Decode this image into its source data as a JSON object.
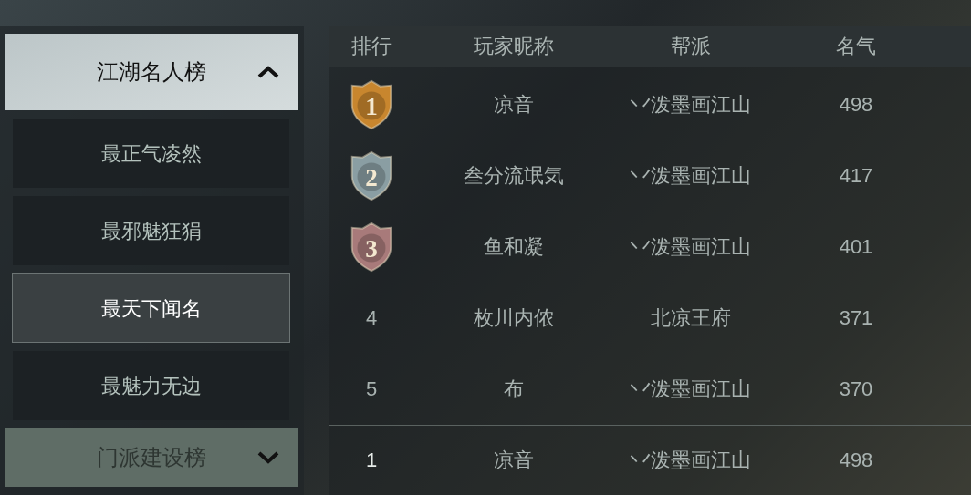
{
  "sidebar": {
    "groups": [
      {
        "label": "江湖名人榜",
        "expanded": true,
        "items": [
          {
            "label": "最正气凌然",
            "selected": false
          },
          {
            "label": "最邪魅狂狷",
            "selected": false
          },
          {
            "label": "最天下闻名",
            "selected": true
          },
          {
            "label": "最魅力无边",
            "selected": false
          }
        ]
      },
      {
        "label": "门派建设榜",
        "expanded": false
      }
    ]
  },
  "table": {
    "columns": [
      "排行",
      "玩家昵称",
      "帮派",
      "名气"
    ],
    "rows": [
      {
        "kind": "medal",
        "rank": "1",
        "color": "#c8862e",
        "name": "凉音",
        "guild": "丷泼墨画江山",
        "fame": "498"
      },
      {
        "kind": "medal",
        "rank": "2",
        "color": "#8a9ea3",
        "name": "叁分流氓気",
        "guild": "丷泼墨画江山",
        "fame": "417"
      },
      {
        "kind": "medal",
        "rank": "3",
        "color": "#a87a7a",
        "name": "鱼和凝",
        "guild": "丷泼墨画江山",
        "fame": "401"
      },
      {
        "kind": "number",
        "rank": "4",
        "name": "枚川内侬",
        "guild": "北凉王府",
        "fame": "371"
      },
      {
        "kind": "number",
        "rank": "5",
        "name": "布",
        "guild": "丷泼墨画江山",
        "fame": "370"
      }
    ],
    "own_row": {
      "rank": "1",
      "name": "凉音",
      "guild": "丷泼墨画江山",
      "fame": "498"
    }
  }
}
